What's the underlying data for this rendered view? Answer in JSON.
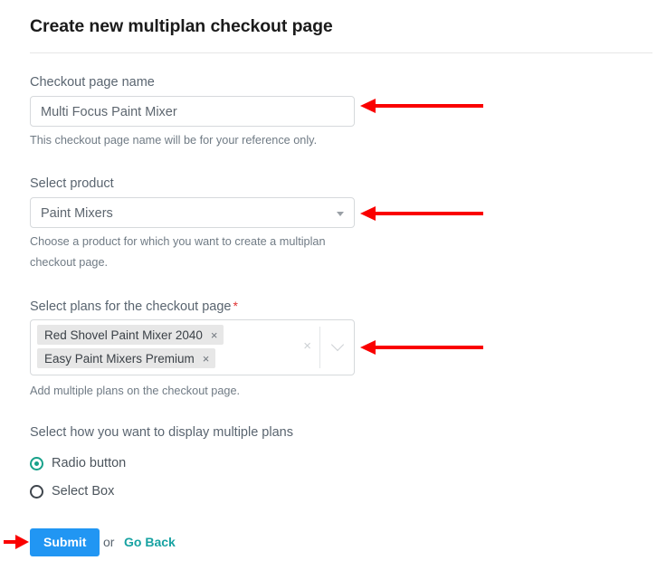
{
  "header": {
    "title": "Create new multiplan checkout page"
  },
  "form": {
    "checkout_name": {
      "label": "Checkout page name",
      "value": "Multi Focus Paint Mixer",
      "placeholder": "Checkout page name",
      "help": "This checkout page name will be for your reference only."
    },
    "product": {
      "label": "Select product",
      "value": "Paint Mixers",
      "help_line1": "Choose a product for which you want to create a multiplan",
      "help_line2": "checkout page."
    },
    "plans": {
      "label": "Select plans for the checkout page",
      "required_mark": "*",
      "tags": [
        {
          "label": "Red Shovel Paint Mixer 2040",
          "remove": "×"
        },
        {
          "label": "Easy Paint Mixers Premium",
          "remove": "×"
        }
      ],
      "clear_all": "×",
      "help": "Add multiple plans on the checkout page."
    },
    "display_mode": {
      "label": "Select how you want to display multiple plans",
      "options": [
        {
          "label": "Radio button",
          "selected": true
        },
        {
          "label": "Select Box",
          "selected": false
        }
      ]
    }
  },
  "footer": {
    "submit_label": "Submit",
    "or_label": "or",
    "go_back_label": "Go Back"
  },
  "colors": {
    "primary_button": "#2196f3",
    "link": "#17a2a2",
    "radio_selected": "#18a18a",
    "required_star": "#e03131",
    "annotation_arrow": "#fa0000",
    "tag_background": "#e7e7e7"
  }
}
